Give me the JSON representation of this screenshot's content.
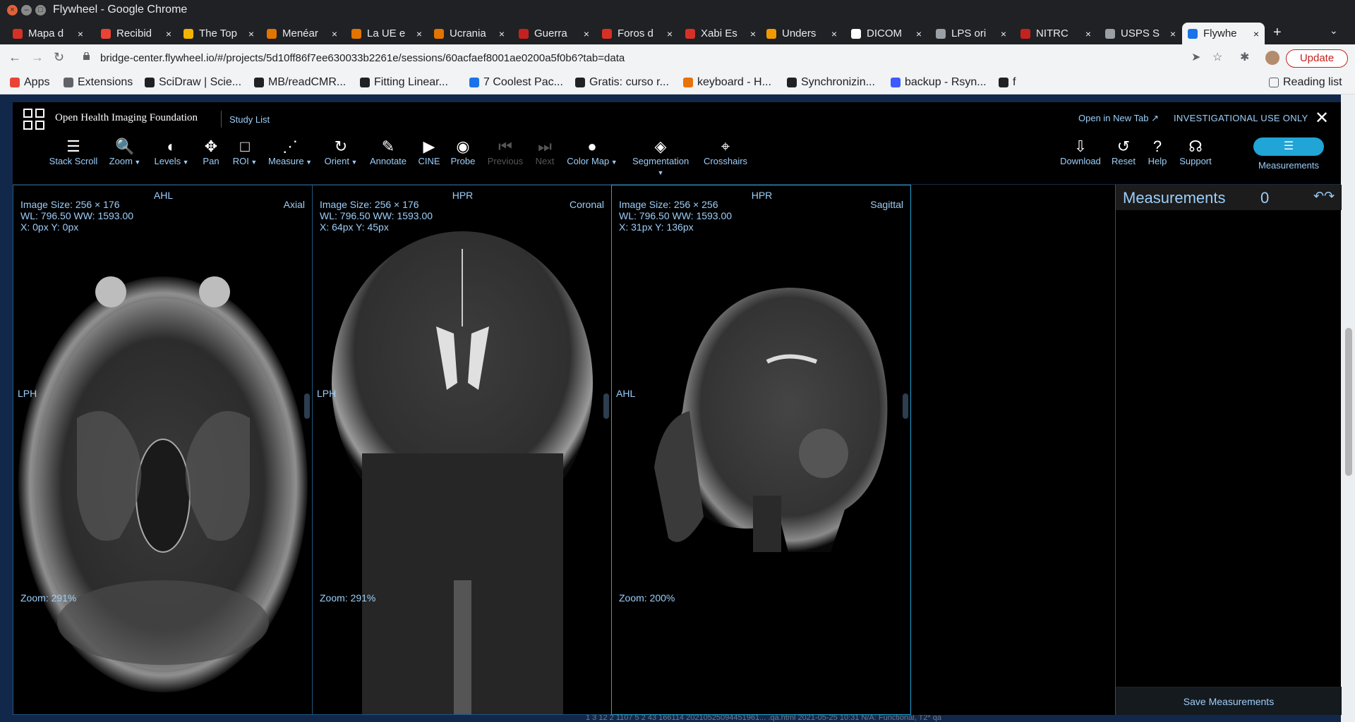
{
  "window": {
    "title": "Flywheel - Google Chrome"
  },
  "tabs": [
    {
      "label": "Mapa d",
      "color": "#d93025"
    },
    {
      "label": "Recibid",
      "color": "#ea4335"
    },
    {
      "label": "The Top",
      "color": "#f4b400"
    },
    {
      "label": "Menéar",
      "color": "#e37400"
    },
    {
      "label": "La UE e",
      "color": "#e37400"
    },
    {
      "label": "Ucrania",
      "color": "#e37400"
    },
    {
      "label": "Guerra",
      "color": "#c5221f"
    },
    {
      "label": "Foros d",
      "color": "#d93025"
    },
    {
      "label": "Xabi Es",
      "color": "#d93025"
    },
    {
      "label": "Unders",
      "color": "#f29900"
    },
    {
      "label": "DICOM",
      "color": "#ffffff"
    },
    {
      "label": "LPS ori",
      "color": "#9aa0a6"
    },
    {
      "label": "NITRC",
      "color": "#c5221f"
    },
    {
      "label": "USPS S",
      "color": "#9aa0a6"
    },
    {
      "label": "Flywhe",
      "color": "#1a73e8"
    }
  ],
  "browser": {
    "url": "bridge-center.flywheel.io/#/projects/5d10ff86f7ee630033b2261e/sessions/60acfaef8001ae0200a5f0b6?tab=data",
    "update_label": "Update"
  },
  "bookmarks": [
    {
      "label": "Apps",
      "color": "#ea4335"
    },
    {
      "label": "Extensions",
      "color": "#5f6368"
    },
    {
      "label": "SciDraw | Scie...",
      "color": "#202124"
    },
    {
      "label": "MB/readCMR...",
      "color": "#202124"
    },
    {
      "label": "Fitting Linear...",
      "color": "#202124"
    },
    {
      "label": "7 Coolest Pac...",
      "color": "#1a73e8"
    },
    {
      "label": "Gratis: curso r...",
      "color": "#202124"
    },
    {
      "label": "keyboard - H...",
      "color": "#e8710a"
    },
    {
      "label": "Synchronizin...",
      "color": "#202124"
    },
    {
      "label": "backup - Rsyn...",
      "color": "#3d5afe"
    },
    {
      "label": "f",
      "color": "#202124"
    }
  ],
  "reading_list": "Reading list",
  "ohif": {
    "brand": "Open Health Imaging Foundation",
    "study_list": "Study List",
    "open_new_tab": "Open in New Tab ↗",
    "investigational": "INVESTIGATIONAL USE ONLY",
    "tools": [
      {
        "label": "Stack Scroll",
        "icon": "stack-scroll-icon",
        "glyph": "☰"
      },
      {
        "label": "Zoom",
        "icon": "zoom-icon",
        "glyph": "🔍",
        "caret": true
      },
      {
        "label": "Levels",
        "icon": "levels-icon",
        "glyph": "◐",
        "caret": true
      },
      {
        "label": "Pan",
        "icon": "pan-icon",
        "glyph": "✥"
      },
      {
        "label": "ROI",
        "icon": "roi-icon",
        "glyph": "□",
        "caret": true
      },
      {
        "label": "Measure",
        "icon": "measure-icon",
        "glyph": "⋰",
        "caret": true
      },
      {
        "label": "Orient",
        "icon": "orient-icon",
        "glyph": "↻",
        "caret": true
      },
      {
        "label": "Annotate",
        "icon": "annotate-icon",
        "glyph": "✎"
      },
      {
        "label": "CINE",
        "icon": "cine-icon",
        "glyph": "▶"
      },
      {
        "label": "Probe",
        "icon": "probe-icon",
        "glyph": "◉"
      },
      {
        "label": "Previous",
        "icon": "previous-icon",
        "glyph": "⏮",
        "dim": true
      },
      {
        "label": "Next",
        "icon": "next-icon",
        "glyph": "⏭",
        "dim": true
      },
      {
        "label": "Color Map",
        "icon": "color-map-icon",
        "glyph": "●",
        "caret": true
      },
      {
        "label": "Segmentation",
        "icon": "segmentation-icon",
        "glyph": "◈",
        "caret": true
      },
      {
        "label": "Crosshairs",
        "icon": "crosshairs-icon",
        "glyph": "⌖"
      },
      {
        "label": "Download",
        "icon": "download-icon",
        "glyph": "⇩"
      },
      {
        "label": "Reset",
        "icon": "reset-icon",
        "glyph": "↺"
      },
      {
        "label": "Help",
        "icon": "help-icon",
        "glyph": "?"
      },
      {
        "label": "Support",
        "icon": "support-icon",
        "glyph": "☊"
      }
    ],
    "measurements_toggle": "Measurements",
    "viewports": [
      {
        "top": "AHL",
        "left": "LPH",
        "orientation": "Axial",
        "size": "Image Size: 256 × 176",
        "wlww": "WL: 796.50 WW: 1593.00",
        "xy": "X: 0px Y: 0px",
        "zoom": "Zoom: 291%"
      },
      {
        "top": "HPR",
        "left": "LPH",
        "orientation": "Coronal",
        "size": "Image Size: 256 × 176",
        "wlww": "WL: 796.50 WW: 1593.00",
        "xy": "X: 64px Y: 45px",
        "zoom": "Zoom: 291%"
      },
      {
        "top": "HPR",
        "left": "AHL",
        "orientation": "Sagittal",
        "size": "Image Size: 256 × 256",
        "wlww": "WL: 796.50 WW: 1593.00",
        "xy": "X: 31px Y: 136px",
        "zoom": "Zoom: 200%"
      }
    ],
    "measurements_panel": {
      "title": "Measurements",
      "count": "0",
      "save": "Save Measurements"
    }
  },
  "background_row": "1  3  12  2  1107  5  2  43  166114  20210525094451961...  .qa.html   2021-05-25 10:31          N/A: Functional, T2*          qa"
}
